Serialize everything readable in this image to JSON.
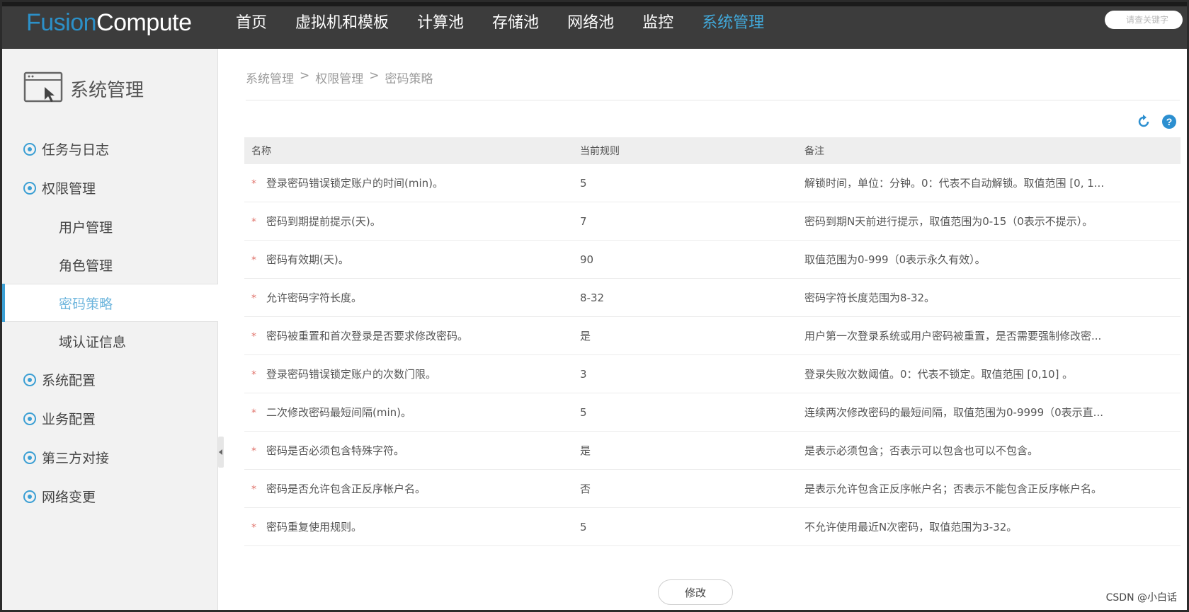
{
  "app": {
    "logo_part1": "Fusion",
    "logo_part2": "Compute"
  },
  "nav": [
    {
      "label": "首页"
    },
    {
      "label": "虚拟机和模板"
    },
    {
      "label": "计算池"
    },
    {
      "label": "存储池"
    },
    {
      "label": "网络池"
    },
    {
      "label": "监控"
    },
    {
      "label": "系统管理"
    }
  ],
  "nav_active": "系统管理",
  "top_search": {
    "placeholder": "请查关键字"
  },
  "sidebar": {
    "title": "系统管理",
    "items": [
      {
        "label": "任务与日志"
      },
      {
        "label": "权限管理"
      },
      {
        "label": "用户管理"
      },
      {
        "label": "角色管理"
      },
      {
        "label": "密码策略"
      },
      {
        "label": "域认证信息"
      },
      {
        "label": "系统配置"
      },
      {
        "label": "业务配置"
      },
      {
        "label": "第三方对接"
      },
      {
        "label": "网络变更"
      }
    ]
  },
  "breadcrumb": [
    "系统管理",
    "权限管理",
    "密码策略"
  ],
  "breadcrumb_sep": ">",
  "table": {
    "headers": [
      "名称",
      "当前规则",
      "备注"
    ],
    "rows": [
      {
        "name": "登录密码错误锁定账户的时间(min)。",
        "value": "5",
        "note": "解锁时间，单位：分钟。0：代表不自动解锁。取值范围 [0, 1..."
      },
      {
        "name": "密码到期提前提示(天)。",
        "value": "7",
        "note": "密码到期N天前进行提示，取值范围为0-15（0表示不提示）。"
      },
      {
        "name": "密码有效期(天)。",
        "value": "90",
        "note": "取值范围为0-999（0表示永久有效）。"
      },
      {
        "name": "允许密码字符长度。",
        "value": "8-32",
        "note": "密码字符长度范围为8-32。"
      },
      {
        "name": "密码被重置和首次登录是否要求修改密码。",
        "value": "是",
        "note": "用户第一次登录系统或用户密码被重置，是否需要强制修改密..."
      },
      {
        "name": "登录密码错误锁定账户的次数门限。",
        "value": "3",
        "note": "登录失败次数阈值。0：代表不锁定。取值范围 [0,10] 。"
      },
      {
        "name": "二次修改密码最短间隔(min)。",
        "value": "5",
        "note": "连续两次修改密码的最短间隔，取值范围为0-9999（0表示直..."
      },
      {
        "name": "密码是否必须包含特殊字符。",
        "value": "是",
        "note": "是表示必须包含；否表示可以包含也可以不包含。"
      },
      {
        "name": "密码是否允许包含正反序帐户名。",
        "value": "否",
        "note": "是表示允许包含正反序帐户名；否表示不能包含正反序帐户名。"
      },
      {
        "name": "密码重复使用规则。",
        "value": "5",
        "note": "不允许使用最近N次密码，取值范围为3-32。"
      }
    ]
  },
  "edit_label": "修改",
  "watermark": "CSDN @小白话"
}
